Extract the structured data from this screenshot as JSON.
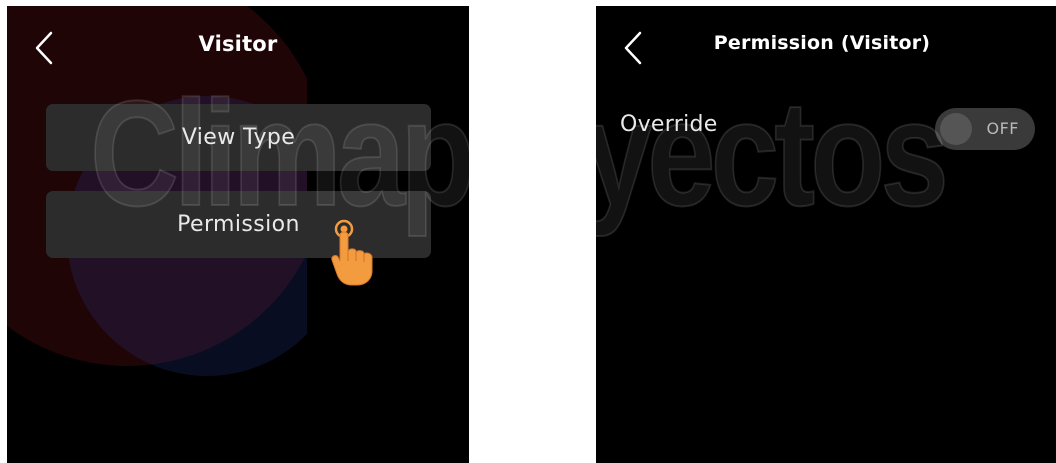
{
  "left_screen": {
    "title": "Visitor",
    "menu": {
      "view_type_label": "View Type",
      "permission_label": "Permission"
    }
  },
  "right_screen": {
    "title": "Permission (Visitor)",
    "override": {
      "label": "Override",
      "state": "OFF"
    }
  },
  "watermark": {
    "text": "Climaproyectos"
  },
  "colors": {
    "background": "#000000",
    "button": "#2c2c2c",
    "text": "#e9e9e9",
    "hand_cursor": "#f39c3f",
    "toggle_off": "#3a3a3a"
  },
  "icons": {
    "back": "chevron-left-icon",
    "pointer": "hand-pointer-icon"
  }
}
